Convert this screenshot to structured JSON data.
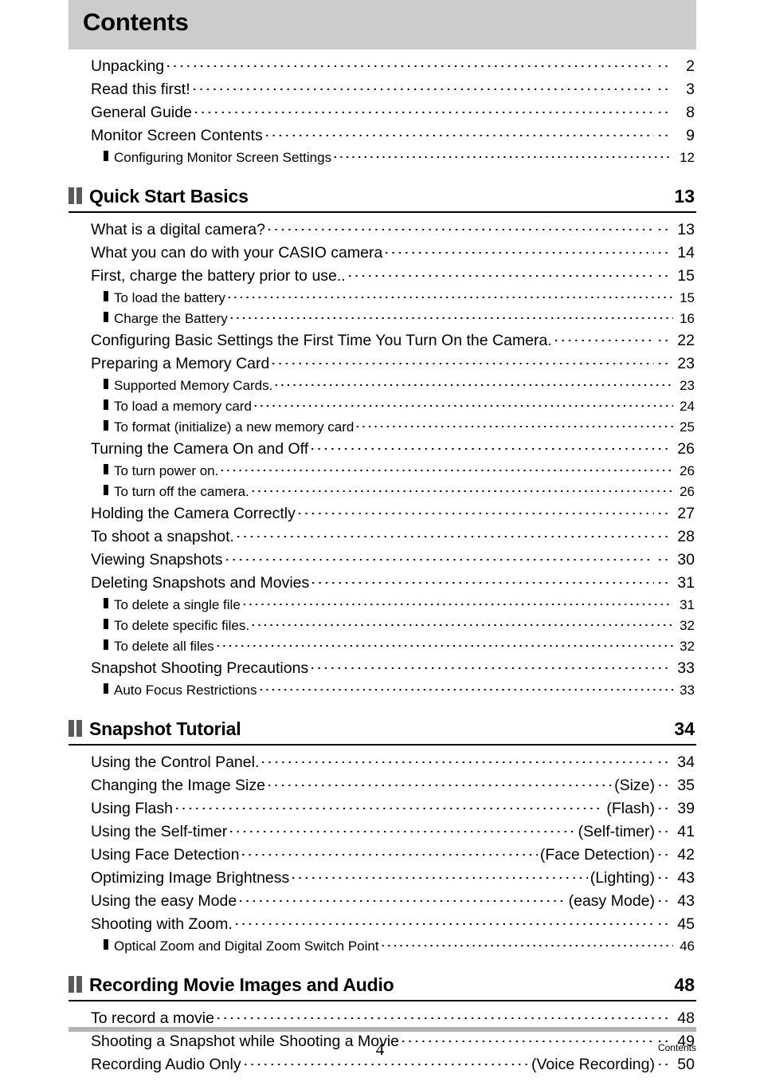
{
  "document": {
    "title": "Contents",
    "footer_page_number": "4",
    "footer_label": "Contents",
    "accent_colors": {
      "title_band": "#cccccc",
      "section_icon": "#595959",
      "footer_rule": "#b3b3b3",
      "text": "#000000"
    }
  },
  "intro_entries": [
    {
      "level": 1,
      "text": "Unpacking",
      "page": "2"
    },
    {
      "level": 1,
      "text": "Read this first!",
      "page": "3"
    },
    {
      "level": 1,
      "text": "General Guide",
      "page": "8"
    },
    {
      "level": 1,
      "text": "Monitor Screen Contents",
      "page": "9"
    },
    {
      "level": 2,
      "text": "Configuring Monitor Screen Settings",
      "page": "12"
    }
  ],
  "sections": [
    {
      "icon": "double-bar-icon",
      "title": "Quick Start Basics",
      "page": "13",
      "entries": [
        {
          "level": 1,
          "text": "What is a digital camera?",
          "page": "13"
        },
        {
          "level": 1,
          "text": "What you can do with your CASIO camera",
          "page": "14"
        },
        {
          "level": 1,
          "text": "First, charge the battery prior to use..",
          "page": "15"
        },
        {
          "level": 2,
          "text": "To load the battery",
          "page": "15"
        },
        {
          "level": 2,
          "text": "Charge the Battery",
          "page": "16"
        },
        {
          "level": 1,
          "text": "Configuring Basic Settings the First Time You Turn On the Camera.",
          "page": "22"
        },
        {
          "level": 1,
          "text": "Preparing a Memory Card",
          "page": "23"
        },
        {
          "level": 2,
          "text": "Supported Memory Cards.",
          "page": "23"
        },
        {
          "level": 2,
          "text": "To load a memory card",
          "page": "24"
        },
        {
          "level": 2,
          "text": "To format (initialize) a new memory card",
          "page": "25"
        },
        {
          "level": 1,
          "text": "Turning the Camera On and Off",
          "page": "26"
        },
        {
          "level": 2,
          "text": "To turn power on.",
          "page": "26"
        },
        {
          "level": 2,
          "text": "To turn off the camera.",
          "page": "26"
        },
        {
          "level": 1,
          "text": "Holding the Camera Correctly",
          "page": "27"
        },
        {
          "level": 1,
          "text": "To shoot a snapshot.",
          "page": "28"
        },
        {
          "level": 1,
          "text": "Viewing Snapshots",
          "page": "30"
        },
        {
          "level": 1,
          "text": "Deleting Snapshots and Movies",
          "page": "31"
        },
        {
          "level": 2,
          "text": "To delete a single file",
          "page": "31"
        },
        {
          "level": 2,
          "text": "To delete specific files.",
          "page": "32"
        },
        {
          "level": 2,
          "text": "To delete all files",
          "page": "32"
        },
        {
          "level": 1,
          "text": "Snapshot Shooting Precautions",
          "page": "33"
        },
        {
          "level": 2,
          "text": "Auto Focus Restrictions",
          "page": "33"
        }
      ]
    },
    {
      "icon": "double-bar-icon",
      "title": "Snapshot Tutorial",
      "page": "34",
      "entries": [
        {
          "level": 1,
          "text": "Using the Control Panel.",
          "page": "34"
        },
        {
          "level": 1,
          "text": "Changing the Image Size",
          "paren": "(Size)",
          "page": "35"
        },
        {
          "level": 1,
          "text": "Using Flash",
          "paren": "(Flash)",
          "page": "39"
        },
        {
          "level": 1,
          "text": "Using the Self-timer",
          "paren": "(Self-timer)",
          "page": "41"
        },
        {
          "level": 1,
          "text": "Using Face Detection",
          "paren": "(Face Detection)",
          "page": "42"
        },
        {
          "level": 1,
          "text": "Optimizing Image Brightness",
          "paren": "(Lighting)",
          "page": "43"
        },
        {
          "level": 1,
          "text": "Using the easy Mode",
          "paren": "(easy Mode)",
          "page": "43"
        },
        {
          "level": 1,
          "text": "Shooting with Zoom.",
          "page": "45"
        },
        {
          "level": 2,
          "text": "Optical Zoom and Digital Zoom Switch Point",
          "page": "46"
        }
      ]
    },
    {
      "icon": "double-bar-icon",
      "title": "Recording Movie Images and Audio",
      "page": "48",
      "entries": [
        {
          "level": 1,
          "text": "To record a movie",
          "page": "48"
        },
        {
          "level": 1,
          "text": "Shooting a Snapshot while Shooting a Movie",
          "page": "49"
        },
        {
          "level": 1,
          "text": "Recording Audio Only",
          "paren": "(Voice Recording)",
          "page": "50"
        }
      ]
    }
  ]
}
